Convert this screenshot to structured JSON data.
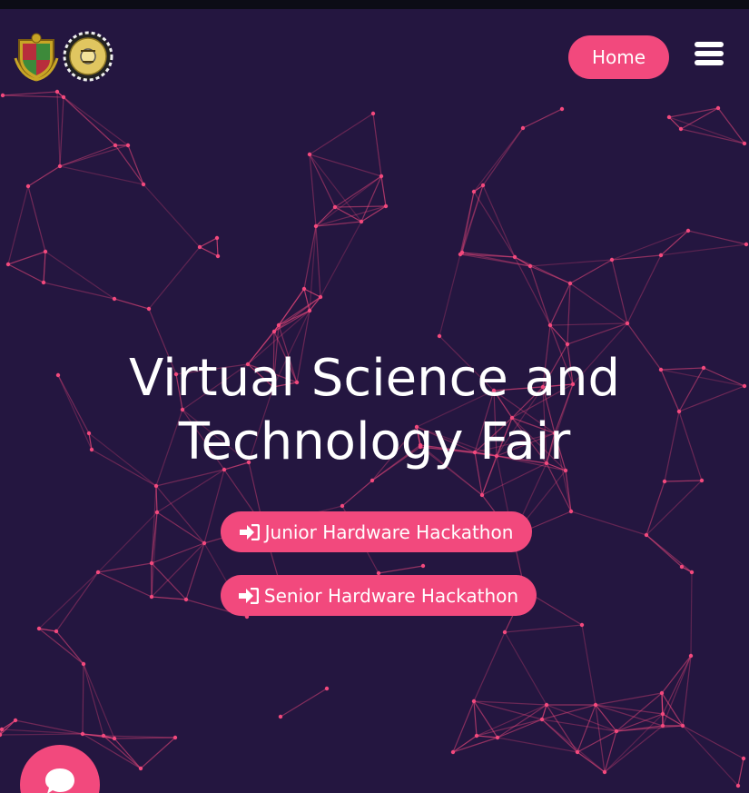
{
  "header": {
    "logos": [
      "crest-logo",
      "gear-emblem-logo"
    ],
    "home_label": "Home",
    "menu_icon": "hamburger-menu-icon"
  },
  "hero": {
    "title_line1": "Virtual Science and",
    "title_line2": "Technology Fair",
    "buttons": [
      {
        "label": "Junior Hardware Hackathon",
        "icon": "sign-in-icon"
      },
      {
        "label": "Senior Hardware Hackathon",
        "icon": "sign-in-icon"
      }
    ]
  },
  "chat": {
    "icon": "chat-bubble-icon"
  },
  "colors": {
    "background": "#241640",
    "accent": "#f2497d",
    "text": "#ffffff",
    "topbar": "#0c0c16"
  }
}
